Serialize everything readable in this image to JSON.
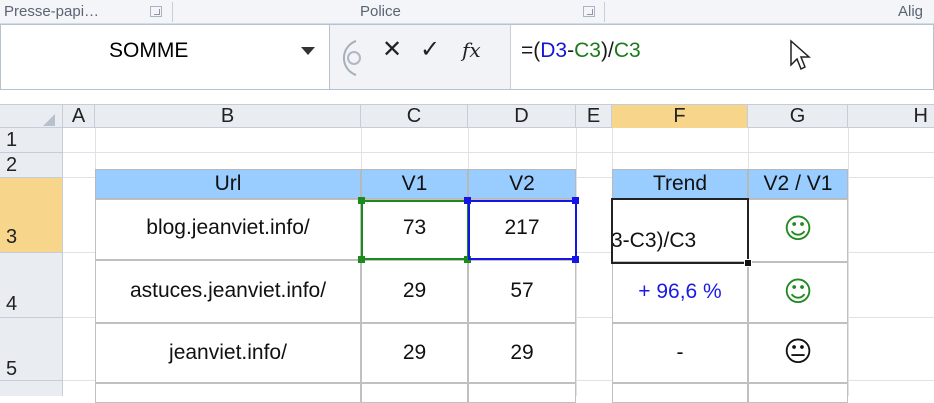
{
  "ribbon": {
    "groups": [
      {
        "label": "Presse-papi…"
      },
      {
        "label": "Police"
      },
      {
        "label": "Alig"
      }
    ]
  },
  "formula_bar": {
    "name_box": "SOMME",
    "cancel_icon": "✕",
    "enter_icon": "✓",
    "fx_label": "fx",
    "formula_parts": [
      "=(",
      "D3",
      "-",
      "C3",
      ")/",
      "C3"
    ]
  },
  "columns": [
    "A",
    "B",
    "C",
    "D",
    "E",
    "F",
    "G",
    "H"
  ],
  "rows": [
    "1",
    "2",
    "3",
    "4",
    "5"
  ],
  "active": {
    "column": "F",
    "row": "3"
  },
  "table1": {
    "headers": [
      "Url",
      "V1",
      "V2"
    ],
    "rows": [
      [
        "blog.jeanviet.info/",
        "73",
        "217"
      ],
      [
        "astuces.jeanviet.info/",
        "29",
        "57"
      ],
      [
        "jeanviet.info/",
        "29",
        "29"
      ]
    ]
  },
  "table2": {
    "headers": [
      "Trend",
      "V2 / V1"
    ],
    "rows": [
      {
        "trend": "3-C3)/C3",
        "icon": "smile",
        "icon_color": "green"
      },
      {
        "trend": "+ 96,6 %",
        "icon": "smile",
        "icon_color": "green"
      },
      {
        "trend": "-",
        "icon": "neutral",
        "icon_color": "black"
      }
    ]
  },
  "colors": {
    "header_fill": "#99ccff",
    "green_ref": "#1c7a1c",
    "blue_ref": "#1515d6",
    "selected_header": "#f7d58a"
  }
}
